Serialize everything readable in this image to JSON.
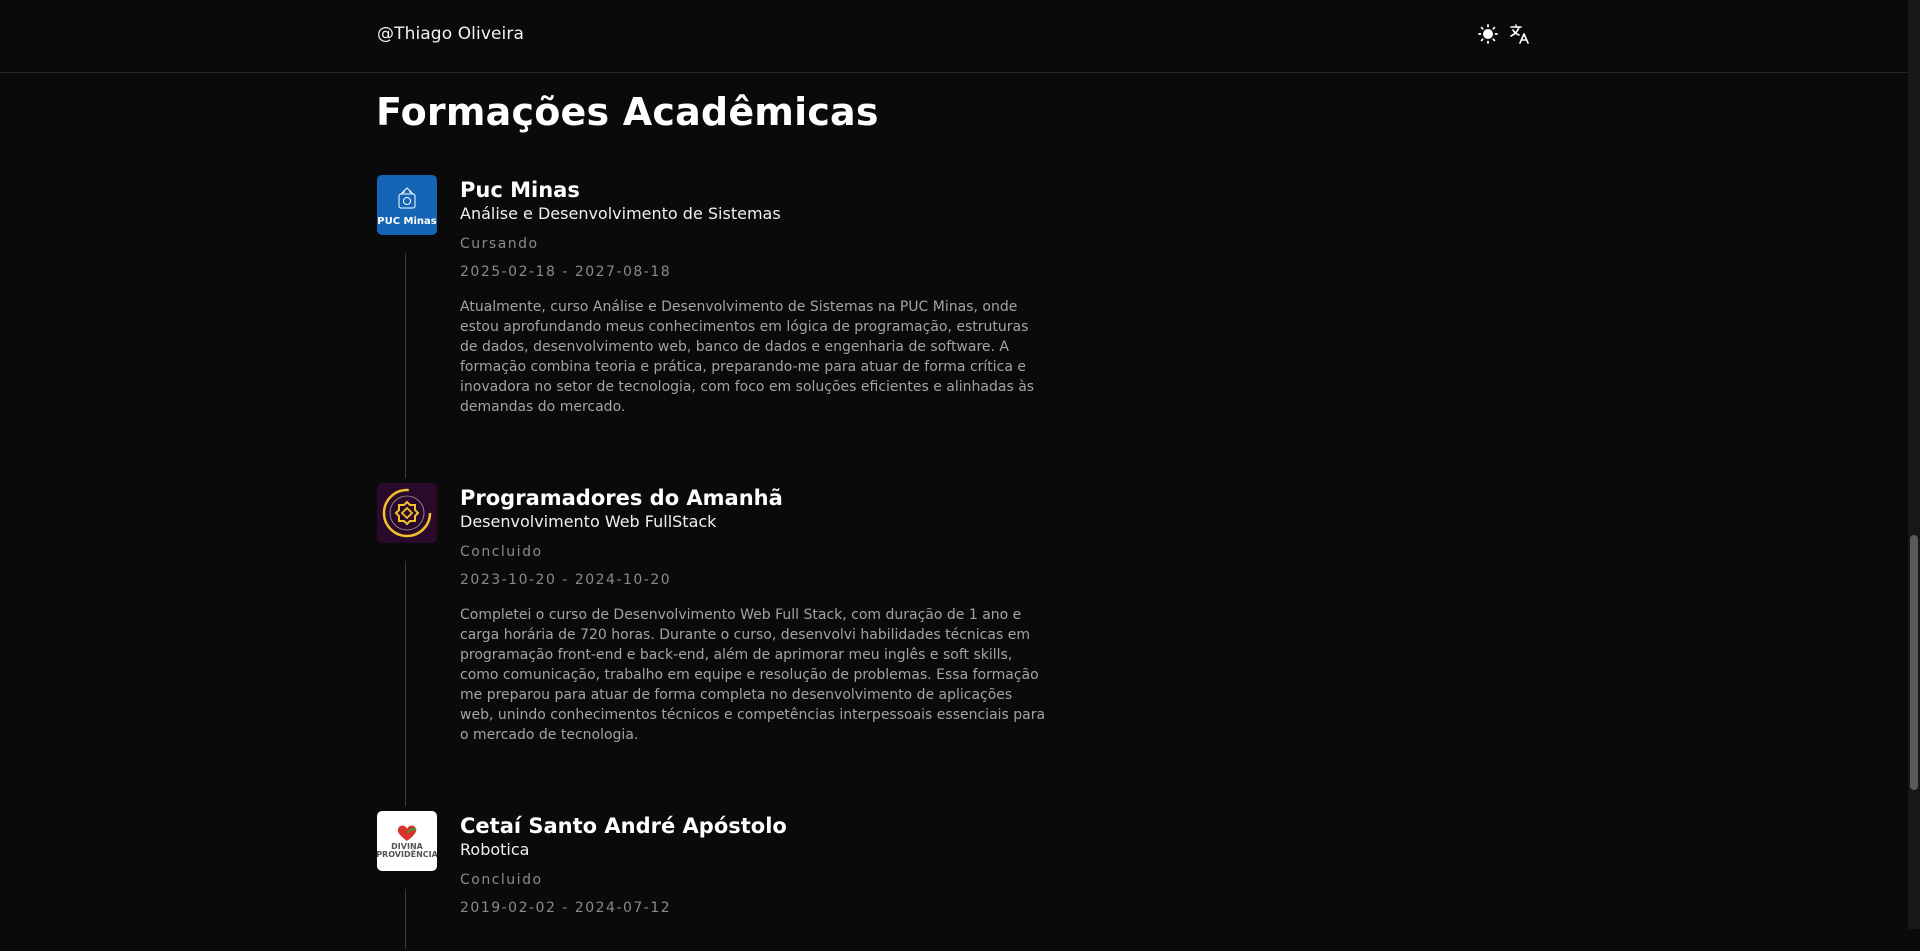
{
  "header": {
    "brand": "@Thiago Oliveira",
    "theme_icon": "sun-icon",
    "language_icon": "translate-icon"
  },
  "page": {
    "title": "Formações Acadêmicas"
  },
  "education": [
    {
      "institution": "Puc Minas",
      "logo_text": "PUC Minas",
      "course": "Análise e Desenvolvimento de Sistemas",
      "status": "Cursando",
      "dates": "2025-02-18 - 2027-08-18",
      "description": "Atualmente, curso Análise e Desenvolvimento de Sistemas na PUC Minas, onde estou aprofundando meus conhecimentos em lógica de programação, estruturas de dados, desenvolvimento web, banco de dados e engenharia de software. A formação combina teoria e prática, preparando-me para atuar de forma crítica e inovadora no setor de tecnologia, com foco em soluções eficientes e alinhadas às demandas do mercado."
    },
    {
      "institution": "Programadores do Amanhã",
      "course": "Desenvolvimento Web FullStack",
      "status": "Concluido",
      "dates": "2023-10-20 - 2024-10-20",
      "description": "Completei o curso de Desenvolvimento Web Full Stack, com duração de 1 ano e carga horária de 720 horas. Durante o curso, desenvolvi habilidades técnicas em programação front-end e back-end, além de aprimorar meu inglês e soft skills, como comunicação, trabalho em equipe e resolução de problemas. Essa formação me preparou para atuar de forma completa no desenvolvimento de aplicações web, unindo conhecimentos técnicos e competências interpessoais essenciais para o mercado de tecnologia."
    },
    {
      "institution": "Cetaí Santo André Apóstolo",
      "logo_text_1": "DIVINA",
      "logo_text_2": "PROVIDÊNCIA",
      "course": "Robotica",
      "status": "Concluido",
      "dates": "2019-02-02 - 2024-07-12"
    }
  ],
  "colors": {
    "background": "#0a0a0a",
    "puc_blue": "#1565b6",
    "prog_gold": "#f2c12e"
  }
}
